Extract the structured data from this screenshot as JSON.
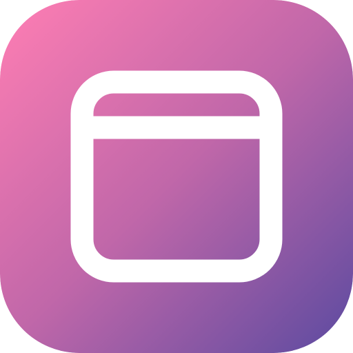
{
  "icon": {
    "name": "browser-window-icon",
    "gradient_start": "#ff7eb3",
    "gradient_mid": "#c067a9",
    "gradient_end": "#5b4aa0",
    "glyph_color": "#ffffff"
  }
}
